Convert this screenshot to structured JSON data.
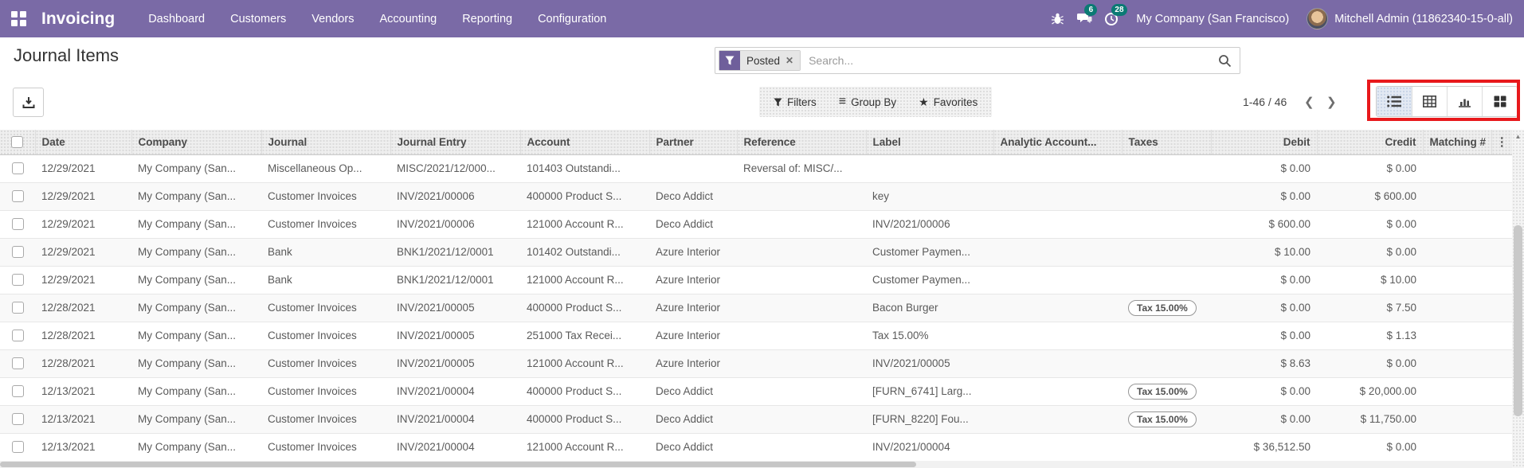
{
  "colors": {
    "navbar_bg": "#7a6aa6",
    "badge_bg": "#0b7a74",
    "annotation_red": "#e8191c",
    "facet_icon_bg": "#6f5f9b",
    "active_view_bg": "#e3e9f3"
  },
  "icons": {
    "close": "✕",
    "group_by_bars": "≡",
    "favorites_star": "★",
    "prev_chevron": "❮",
    "next_chevron": "❯",
    "options_dots": "⋮",
    "scroll_up_arrow": "▲"
  },
  "navbar": {
    "app_name": "Invoicing",
    "menus": [
      "Dashboard",
      "Customers",
      "Vendors",
      "Accounting",
      "Reporting",
      "Configuration"
    ],
    "messages_count": "6",
    "activities_count": "28",
    "company": "My Company (San Francisco)",
    "user": "Mitchell Admin (11862340-15-0-all)"
  },
  "control_panel": {
    "title": "Journal Items",
    "search": {
      "facet_label": "Posted",
      "placeholder": "Search..."
    },
    "buttons": {
      "filters": "Filters",
      "group_by": "Group By",
      "favorites": "Favorites"
    },
    "pager": {
      "value": "1-46 / 46"
    }
  },
  "table": {
    "columns": [
      "Date",
      "Company",
      "Journal",
      "Journal Entry",
      "Account",
      "Partner",
      "Reference",
      "Label",
      "Analytic Account...",
      "Taxes",
      "Debit",
      "Credit",
      "Matching #"
    ],
    "rows": [
      {
        "date": "12/29/2021",
        "company": "My Company (San...",
        "journal": "Miscellaneous Op...",
        "entry": "MISC/2021/12/000...",
        "account": "101403 Outstandi...",
        "partner": "",
        "reference": "Reversal of: MISC/...",
        "label": "",
        "analytic": "",
        "tax": "",
        "debit": "$ 0.00",
        "credit": "$ 0.00",
        "matching": ""
      },
      {
        "date": "12/29/2021",
        "company": "My Company (San...",
        "journal": "Customer Invoices",
        "entry": "INV/2021/00006",
        "account": "400000 Product S...",
        "partner": "Deco Addict",
        "reference": "",
        "label": "key",
        "analytic": "",
        "tax": "",
        "debit": "$ 0.00",
        "credit": "$ 600.00",
        "matching": ""
      },
      {
        "date": "12/29/2021",
        "company": "My Company (San...",
        "journal": "Customer Invoices",
        "entry": "INV/2021/00006",
        "account": "121000 Account R...",
        "partner": "Deco Addict",
        "reference": "",
        "label": "INV/2021/00006",
        "analytic": "",
        "tax": "",
        "debit": "$ 600.00",
        "credit": "$ 0.00",
        "matching": ""
      },
      {
        "date": "12/29/2021",
        "company": "My Company (San...",
        "journal": "Bank",
        "entry": "BNK1/2021/12/0001",
        "account": "101402 Outstandi...",
        "partner": "Azure Interior",
        "reference": "",
        "label": "Customer Paymen...",
        "analytic": "",
        "tax": "",
        "debit": "$ 10.00",
        "credit": "$ 0.00",
        "matching": ""
      },
      {
        "date": "12/29/2021",
        "company": "My Company (San...",
        "journal": "Bank",
        "entry": "BNK1/2021/12/0001",
        "account": "121000 Account R...",
        "partner": "Azure Interior",
        "reference": "",
        "label": "Customer Paymen...",
        "analytic": "",
        "tax": "",
        "debit": "$ 0.00",
        "credit": "$ 10.00",
        "matching": ""
      },
      {
        "date": "12/28/2021",
        "company": "My Company (San...",
        "journal": "Customer Invoices",
        "entry": "INV/2021/00005",
        "account": "400000 Product S...",
        "partner": "Azure Interior",
        "reference": "",
        "label": "Bacon Burger",
        "analytic": "",
        "tax": "Tax 15.00%",
        "debit": "$ 0.00",
        "credit": "$ 7.50",
        "matching": ""
      },
      {
        "date": "12/28/2021",
        "company": "My Company (San...",
        "journal": "Customer Invoices",
        "entry": "INV/2021/00005",
        "account": "251000 Tax Recei...",
        "partner": "Azure Interior",
        "reference": "",
        "label": "Tax 15.00%",
        "analytic": "",
        "tax": "",
        "debit": "$ 0.00",
        "credit": "$ 1.13",
        "matching": ""
      },
      {
        "date": "12/28/2021",
        "company": "My Company (San...",
        "journal": "Customer Invoices",
        "entry": "INV/2021/00005",
        "account": "121000 Account R...",
        "partner": "Azure Interior",
        "reference": "",
        "label": "INV/2021/00005",
        "analytic": "",
        "tax": "",
        "debit": "$ 8.63",
        "credit": "$ 0.00",
        "matching": ""
      },
      {
        "date": "12/13/2021",
        "company": "My Company (San...",
        "journal": "Customer Invoices",
        "entry": "INV/2021/00004",
        "account": "400000 Product S...",
        "partner": "Deco Addict",
        "reference": "",
        "label": "[FURN_6741] Larg...",
        "analytic": "",
        "tax": "Tax 15.00%",
        "debit": "$ 0.00",
        "credit": "$ 20,000.00",
        "matching": ""
      },
      {
        "date": "12/13/2021",
        "company": "My Company (San...",
        "journal": "Customer Invoices",
        "entry": "INV/2021/00004",
        "account": "400000 Product S...",
        "partner": "Deco Addict",
        "reference": "",
        "label": "[FURN_8220] Fou...",
        "analytic": "",
        "tax": "Tax 15.00%",
        "debit": "$ 0.00",
        "credit": "$ 11,750.00",
        "matching": ""
      },
      {
        "date": "12/13/2021",
        "company": "My Company (San...",
        "journal": "Customer Invoices",
        "entry": "INV/2021/00004",
        "account": "121000 Account R...",
        "partner": "Deco Addict",
        "reference": "",
        "label": "INV/2021/00004",
        "analytic": "",
        "tax": "",
        "debit": "$ 36,512.50",
        "credit": "$ 0.00",
        "matching": ""
      }
    ]
  }
}
